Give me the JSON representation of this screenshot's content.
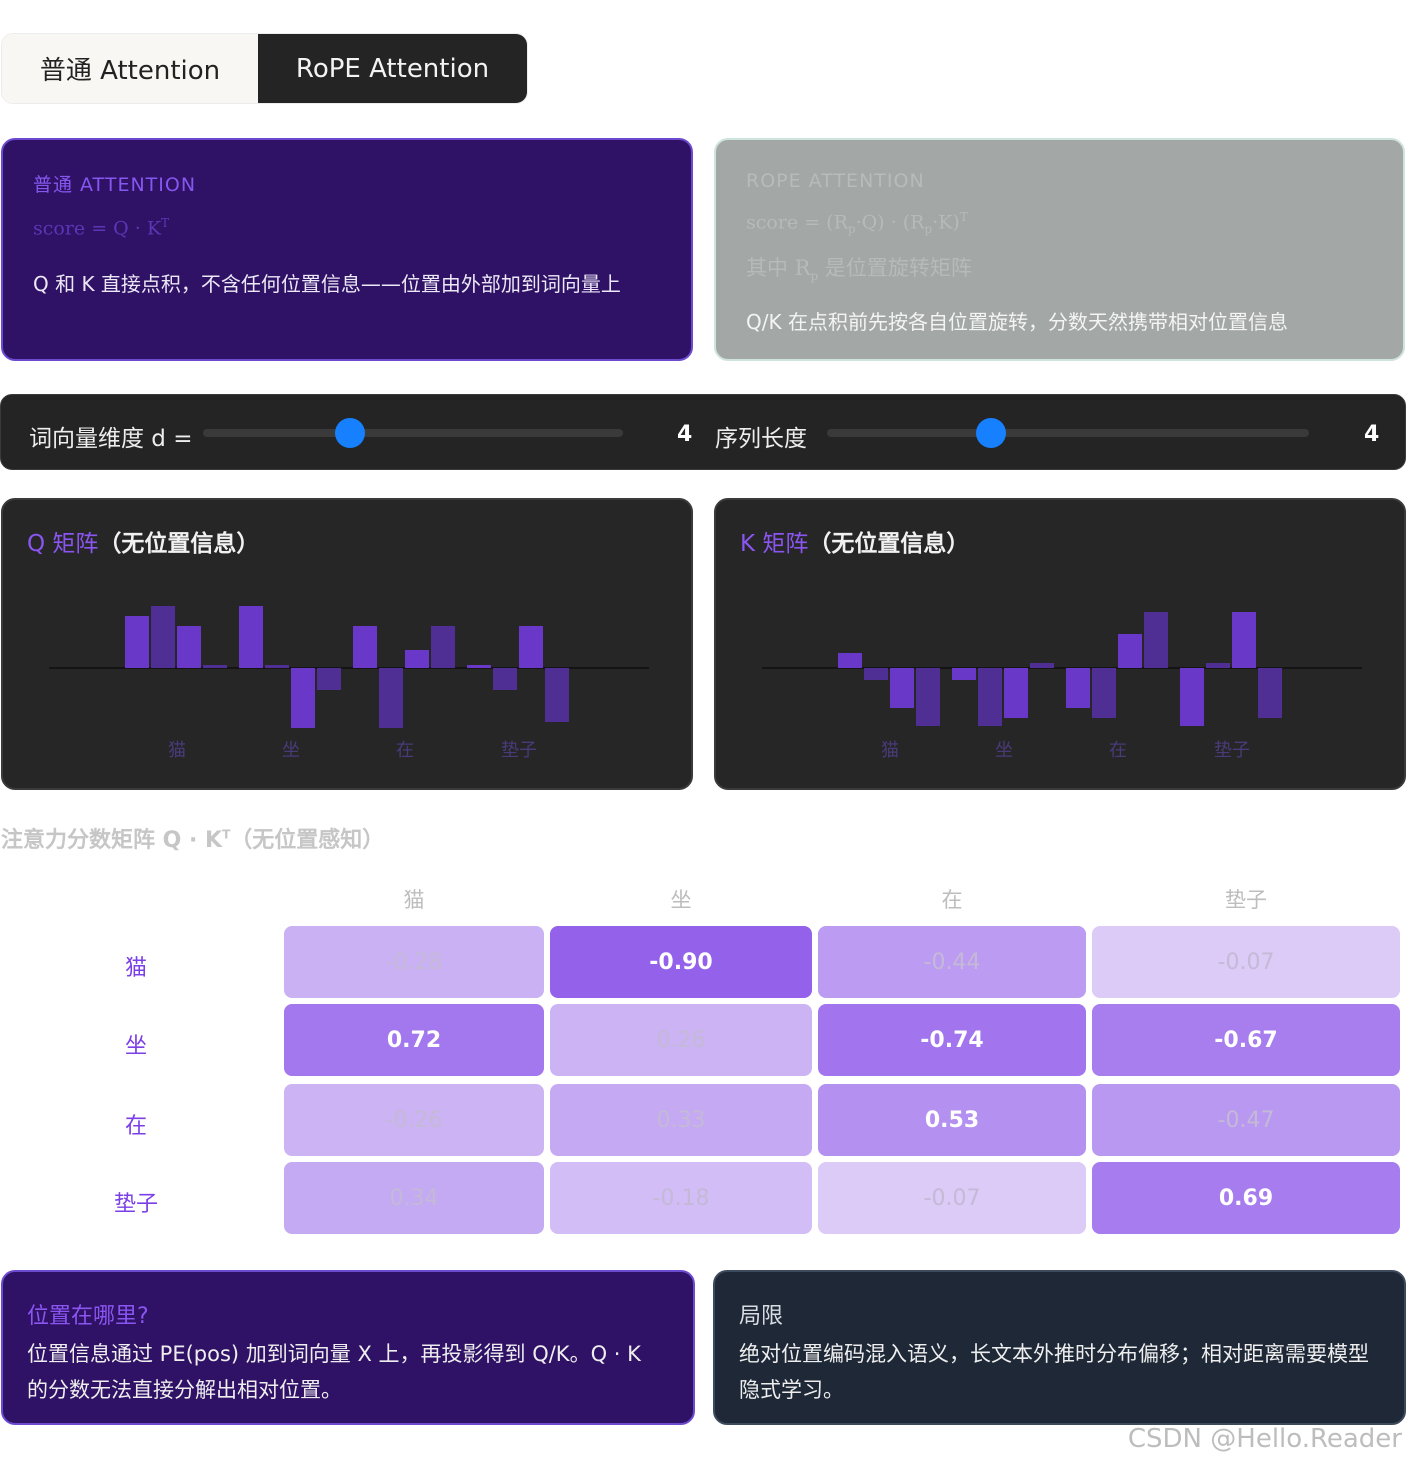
{
  "tabs": [
    {
      "label": "普通 Attention",
      "active": false
    },
    {
      "label": "RoPE Attention",
      "active": true
    }
  ],
  "cards": {
    "plain": {
      "eyebrow": "普通 ATTENTION",
      "formula": "score = Q · K",
      "formula_sup": "T",
      "desc": "Q 和 K 直接点积，不含任何位置信息——位置由外部加到词向量上"
    },
    "rope": {
      "eyebrow": "ROPE ATTENTION",
      "formula": "score = (R",
      "formula_sub1": "p",
      "formula_mid": "·Q) · (R",
      "formula_sub2": "p",
      "formula_end": "·K)",
      "formula_sup": "T",
      "formula2_a": "其中 R",
      "formula2_sub": "p",
      "formula2_b": " 是位置旋转矩阵",
      "desc": "Q/K 在点积前先按各自位置旋转，分数天然携带相对位置信息"
    }
  },
  "sliders": {
    "dim": {
      "label": "词向量维度 d =",
      "value": "4",
      "fraction": 0.35
    },
    "seq": {
      "label": "序列长度",
      "value": "4",
      "fraction": 0.34
    }
  },
  "panels": {
    "q": {
      "title_accent": "Q 矩阵",
      "title_rest": "（无位置信息）"
    },
    "k": {
      "title_accent": "K 矩阵",
      "title_rest": "（无位置信息）"
    }
  },
  "score": {
    "title": "注意力分数矩阵 Q · K",
    "title_sup": "T",
    "title_tail": "（无位置感知）"
  },
  "tokens": [
    "猫",
    "坐",
    "在",
    "垫子"
  ],
  "chart_data": [
    {
      "type": "bar",
      "name": "Q",
      "categories": [
        "猫",
        "坐",
        "在",
        "垫子"
      ],
      "dims": 4,
      "values": [
        [
          0.52,
          0.62,
          0.42,
          0.03
        ],
        [
          0.62,
          0.02,
          -0.6,
          -0.22
        ],
        [
          0.42,
          -0.6,
          0.18,
          0.42
        ],
        [
          0.02,
          -0.22,
          0.42,
          -0.54
        ]
      ]
    },
    {
      "type": "bar",
      "name": "K",
      "categories": [
        "猫",
        "坐",
        "在",
        "垫子"
      ],
      "dims": 4,
      "values": [
        [
          0.15,
          -0.12,
          -0.4,
          -0.58
        ],
        [
          -0.12,
          -0.58,
          -0.5,
          0.05
        ],
        [
          -0.4,
          -0.5,
          0.34,
          0.56
        ],
        [
          -0.58,
          0.05,
          0.56,
          -0.5
        ]
      ]
    },
    {
      "type": "heatmap",
      "name": "score",
      "rows": [
        "猫",
        "坐",
        "在",
        "垫子"
      ],
      "cols": [
        "猫",
        "坐",
        "在",
        "垫子"
      ],
      "values": [
        [
          "-0.28",
          "-0.90",
          "-0.44",
          "-0.07"
        ],
        [
          "0.72",
          "0.26",
          "-0.74",
          "-0.67"
        ],
        [
          "-0.26",
          "0.33",
          "0.53",
          "-0.47"
        ],
        [
          "0.34",
          "-0.18",
          "-0.07",
          "0.69"
        ]
      ]
    }
  ],
  "info": {
    "position": {
      "title": "位置在哪里?",
      "text": "位置信息通过 PE(pos) 加到词向量 X 上，再投影得到 Q/K。Q · K 的分数无法直接分解出相对位置。"
    },
    "limits": {
      "title": "局限",
      "text": "绝对位置编码混入语义，长文本外推时分布偏移；相对距离需要模型隐式学习。"
    }
  },
  "watermark": "CSDN @Hello.Reader",
  "colors": {
    "accent": "#8a55f0",
    "slider_thumb": "#1680ff",
    "bar_bright": "#6a38c8",
    "bar_dim": "#4f2f93"
  }
}
